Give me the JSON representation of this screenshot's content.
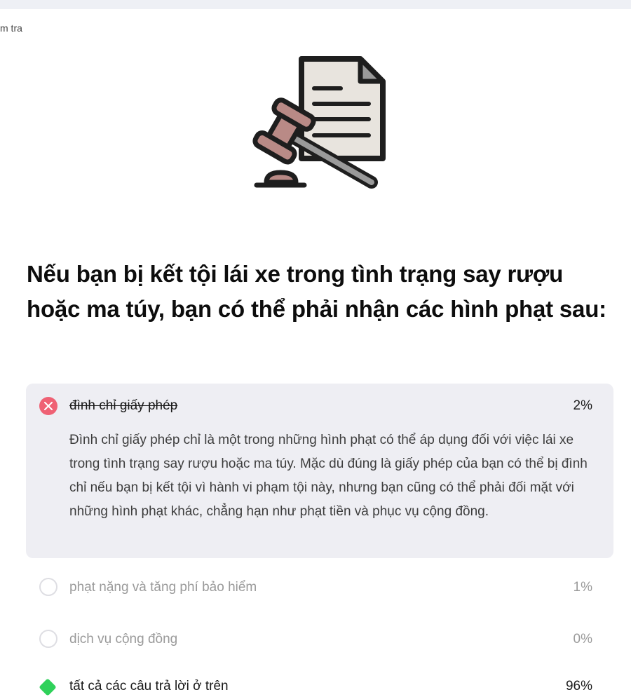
{
  "breadcrumb": "m tra",
  "question": "Nếu bạn bị kết tội lái xe trong tình trạng say rượu hoặc ma túy, bạn có thể phải nhận các hình phạt sau:",
  "options": [
    {
      "label": "đình chỉ giấy phép",
      "percent": "2%",
      "state": "wrong-selected",
      "explanation": "Đình chỉ giấy phép chỉ là một trong những hình phạt có thể áp dụng đối với việc lái xe trong tình trạng say rượu hoặc ma túy. Mặc dù đúng là giấy phép của bạn có thể bị đình chỉ nếu bạn bị kết tội vì hành vi phạm tội này, nhưng bạn cũng có thể phải đối mặt với những hình phạt khác, chẳng hạn như phạt tiền và phục vụ cộng đồng."
    },
    {
      "label": "phạt nặng và tăng phí bảo hiểm",
      "percent": "1%",
      "state": "unselected"
    },
    {
      "label": "dịch vụ cộng đồng",
      "percent": "0%",
      "state": "unselected"
    },
    {
      "label": "tất cả các câu trả lời ở trên",
      "percent": "96%",
      "state": "correct"
    }
  ],
  "icons": {
    "wrong": "x-circle-icon",
    "correct": "check-diamond-icon",
    "empty": "radio-empty-icon",
    "illustration": "gavel-document-icon"
  },
  "colors": {
    "wrong": "#ef6174",
    "correct": "#2fd15a",
    "card_bg": "#eeeef3"
  }
}
